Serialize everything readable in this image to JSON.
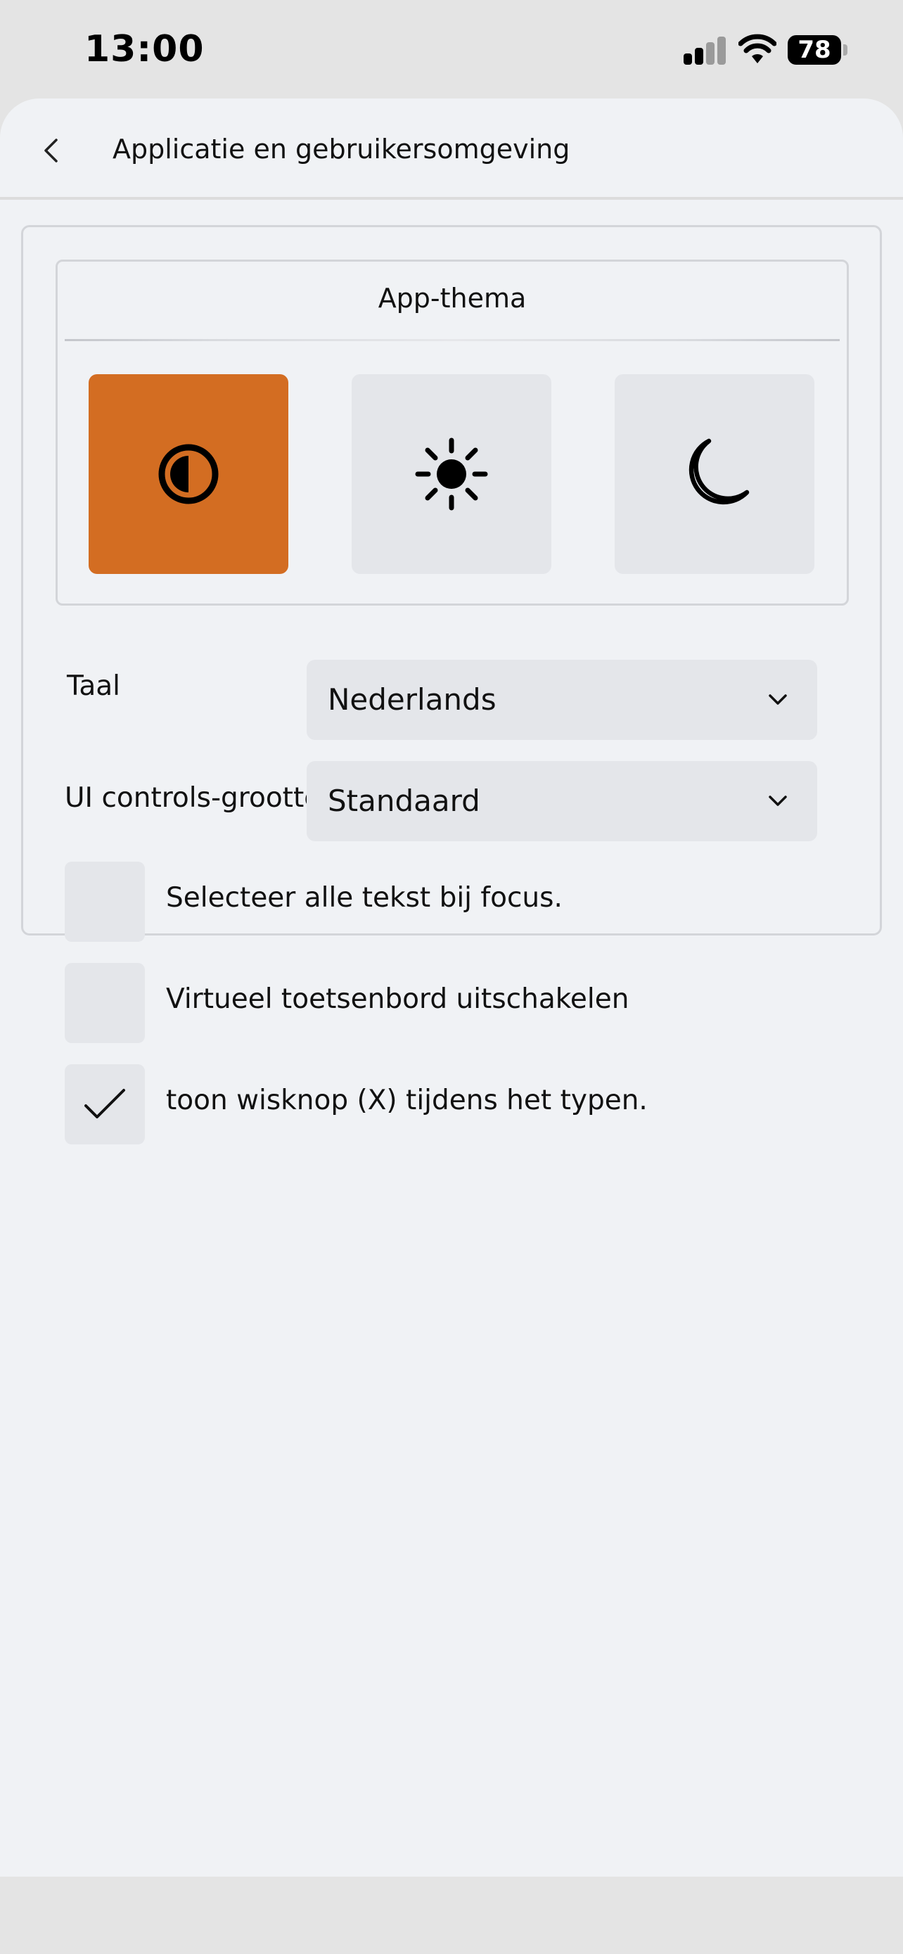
{
  "status_bar": {
    "time": "13:00",
    "battery": "78",
    "icons": [
      "signal-icon",
      "wifi-icon",
      "battery-icon"
    ]
  },
  "header": {
    "back_icon": "chevron-left-icon",
    "title": "Applicatie en gebruikersomgeving"
  },
  "theme": {
    "title": "App-thema",
    "options": [
      {
        "icon": "contrast-icon",
        "selected": true
      },
      {
        "icon": "sun-icon",
        "selected": false
      },
      {
        "icon": "moon-icon",
        "selected": false
      }
    ],
    "accent_color": "#d36d22"
  },
  "language": {
    "label": "Taal",
    "value": "Nederlands",
    "icon": "chevron-down-icon"
  },
  "ui_size": {
    "label": "UI controls-grootte",
    "value": "Standaard",
    "icon": "chevron-down-icon"
  },
  "options": [
    {
      "label": "Selecteer alle tekst bij focus.",
      "checked": false
    },
    {
      "label": "Virtueel toetsenbord uitschakelen",
      "checked": false
    },
    {
      "label": "toon wisknop (X) tijdens het typen.",
      "checked": true
    }
  ]
}
